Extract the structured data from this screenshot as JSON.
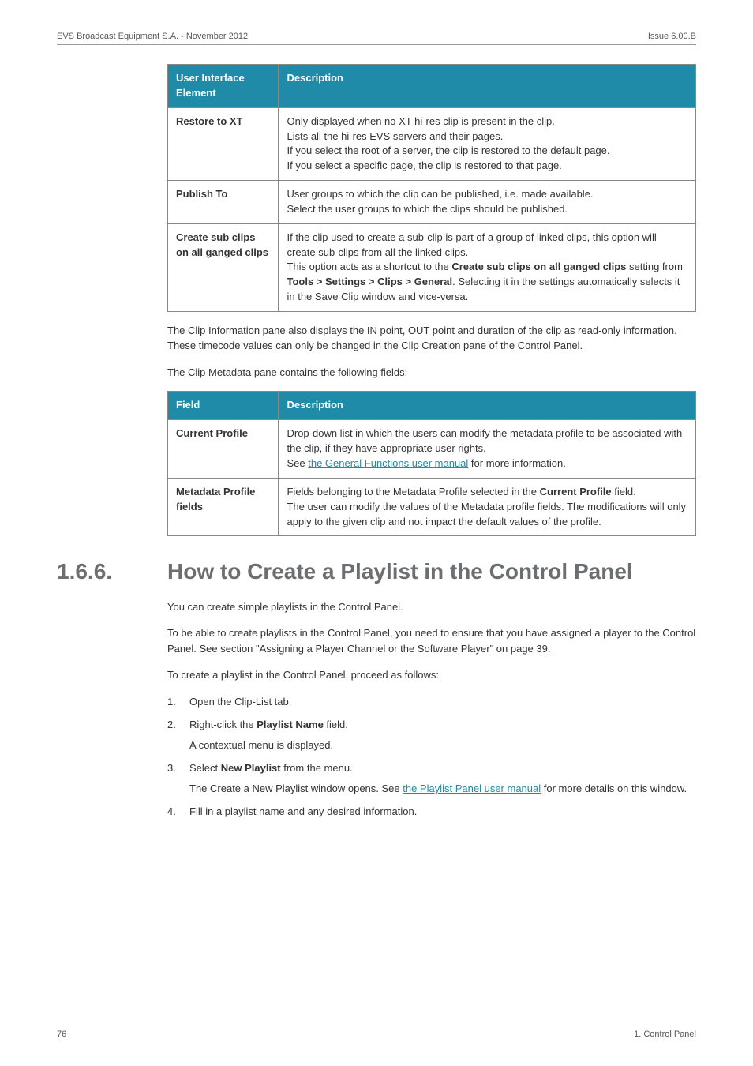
{
  "header": {
    "left": "EVS Broadcast Equipment S.A.  - November 2012",
    "right": "Issue 6.00.B"
  },
  "table1": {
    "head": {
      "c1": "User Interface Element",
      "c2": "Description"
    },
    "rows": [
      {
        "c1": "Restore to XT",
        "lines": [
          "Only displayed when no XT hi-res clip is present in the clip.",
          "Lists all the hi-res EVS servers and their pages.",
          "If you select the root of a server, the clip is restored to the default page.",
          "If you select a specific page, the clip is restored to that page."
        ]
      },
      {
        "c1": "Publish To",
        "lines": [
          "User groups to which the clip can be published, i.e. made available.",
          "Select the user groups to which the clips should be published."
        ]
      },
      {
        "c1": "Create sub clips on all ganged clips",
        "lines_raw": true,
        "html_lines": [
          {
            "pre": "If the clip used to create a sub-clip is part of a group of linked clips, this option will create sub-clips from all the linked clips."
          },
          {
            "pre": "This option acts as a shortcut to the ",
            "b1": "Create sub clips on all ganged clips",
            "mid": " setting from ",
            "b2": "Tools > Settings > Clips > General",
            "post": ". Selecting it in the settings automatically selects it in the Save Clip window and vice-versa."
          }
        ]
      }
    ]
  },
  "para1": "The Clip Information pane also displays the IN point, OUT point and duration of the clip as read-only information. These timecode values can only be changed in the Clip Creation pane of the Control Panel.",
  "para2": "The Clip Metadata pane contains the following fields:",
  "table2": {
    "head": {
      "c1": "Field",
      "c2": "Description"
    },
    "rows": [
      {
        "c1": "Current Profile",
        "lines": [
          {
            "text": "Drop-down list in which the users can modify the metadata profile to be associated with the clip, if they have appropriate user rights."
          },
          {
            "pre": "See ",
            "link": "the General Functions user manual",
            "post": " for more information."
          }
        ]
      },
      {
        "c1": "Metadata Profile fields",
        "lines": [
          {
            "pre": "Fields belonging to the Metadata Profile selected in the ",
            "b": "Current Profile",
            "post": " field."
          },
          {
            "text": "The user can modify the values of the Metadata profile fields. The modifications will only apply to the given clip and not impact the default values of the profile."
          }
        ]
      }
    ]
  },
  "section": {
    "number": "1.6.6.",
    "title": "How to Create a Playlist in the Control Panel"
  },
  "body_paras": {
    "p1": "You can create simple playlists in the Control Panel.",
    "p2": "To be able to create playlists in the Control Panel, you need to ensure that you have assigned a player to the Control Panel. See section \"Assigning a Player Channel or the Software Player\" on page 39.",
    "p3": "To create a playlist in the Control Panel, proceed as follows:"
  },
  "steps": {
    "s1": "Open the Clip-List tab.",
    "s2_pre": "Right-click the ",
    "s2_b": "Playlist Name",
    "s2_post": " field.",
    "s2_sub": "A contextual menu is displayed.",
    "s3_pre": "Select ",
    "s3_b": "New Playlist",
    "s3_post": " from the menu.",
    "s3_sub_pre": "The Create a New Playlist window opens. See ",
    "s3_sub_link": "the Playlist Panel user manual",
    "s3_sub_post": " for more details on this window.",
    "s4": "Fill in a playlist name and any desired information."
  },
  "footer": {
    "left": "76",
    "right": "1. Control Panel"
  }
}
